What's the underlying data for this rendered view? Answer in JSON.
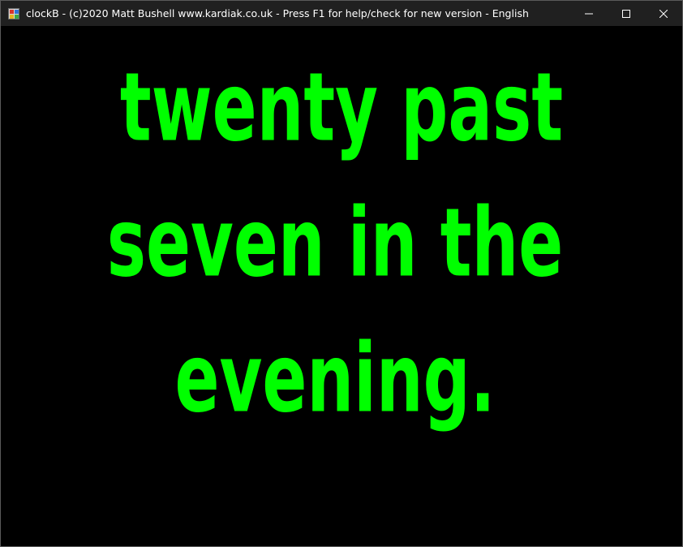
{
  "window": {
    "title": "clockB - (c)2020 Matt Bushell www.kardiak.co.uk - Press F1 for help/check for new version - English",
    "app_icon": "clockb-app-icon",
    "controls": [
      "minimize-icon",
      "maximize-icon",
      "close-icon"
    ]
  },
  "clock": {
    "lines": [
      "twenty past",
      "seven in the",
      "evening."
    ],
    "text_color": "#00ff00",
    "background_color": "#000000"
  }
}
